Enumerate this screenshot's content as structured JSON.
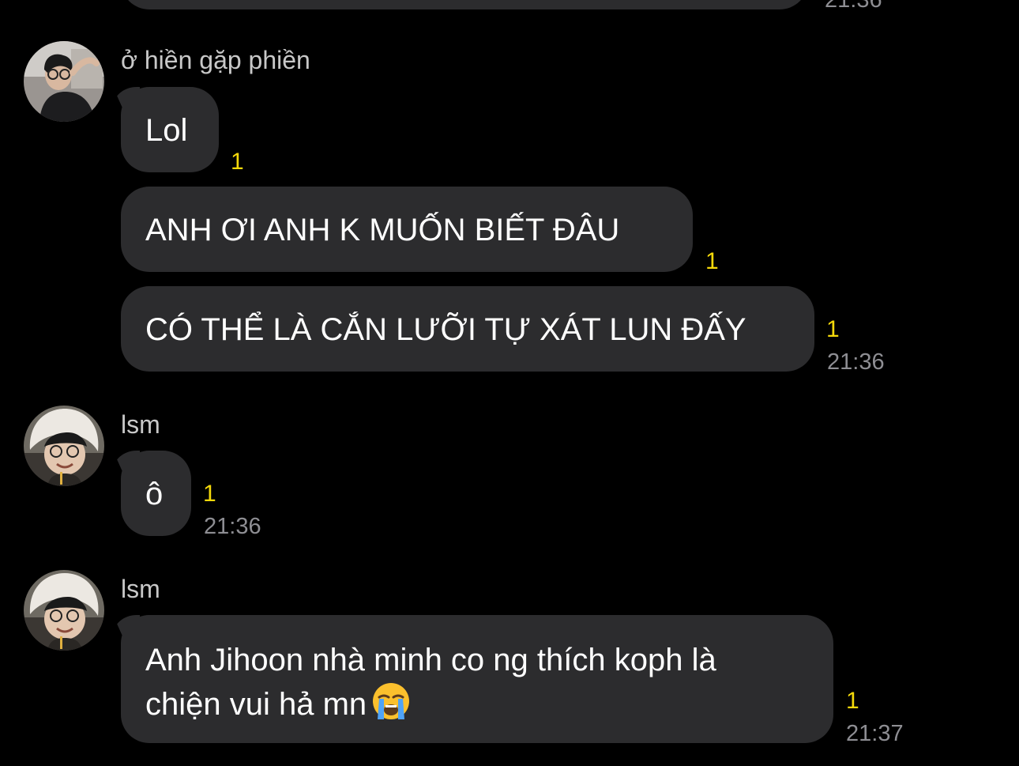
{
  "top_partial": {
    "time": "21:36"
  },
  "messages": [
    {
      "sender": "ở hiền gặp phiền",
      "avatar_icon": "profile-photo-glasses-icon",
      "bubbles": [
        {
          "text": "Lol",
          "unread": "1"
        },
        {
          "text": "ANH ƠI ANH K MUỐN BIẾT ĐÂU",
          "unread": "1"
        },
        {
          "text": "CÓ THỂ LÀ CẮN LƯỠI TỰ XÁT LUN ĐẤY",
          "unread": "1",
          "time": "21:36"
        }
      ]
    },
    {
      "sender": "lsm",
      "avatar_icon": "profile-photo-hat-icon",
      "bubbles": [
        {
          "text": "ô",
          "unread": "1",
          "time": "21:36"
        }
      ]
    },
    {
      "sender": "lsm",
      "avatar_icon": "profile-photo-hat-icon",
      "bubbles": [
        {
          "line1": "Anh Jihoon nhà minh co ng thích koph là",
          "line2": "chiện vui hả mn",
          "emoji": "loudly-crying-face-emoji",
          "unread": "1",
          "time": "21:37"
        }
      ]
    }
  ],
  "colors": {
    "background": "#000000",
    "bubble": "#2c2c2e",
    "unread": "#f5d90a",
    "time": "#8e8e93"
  }
}
